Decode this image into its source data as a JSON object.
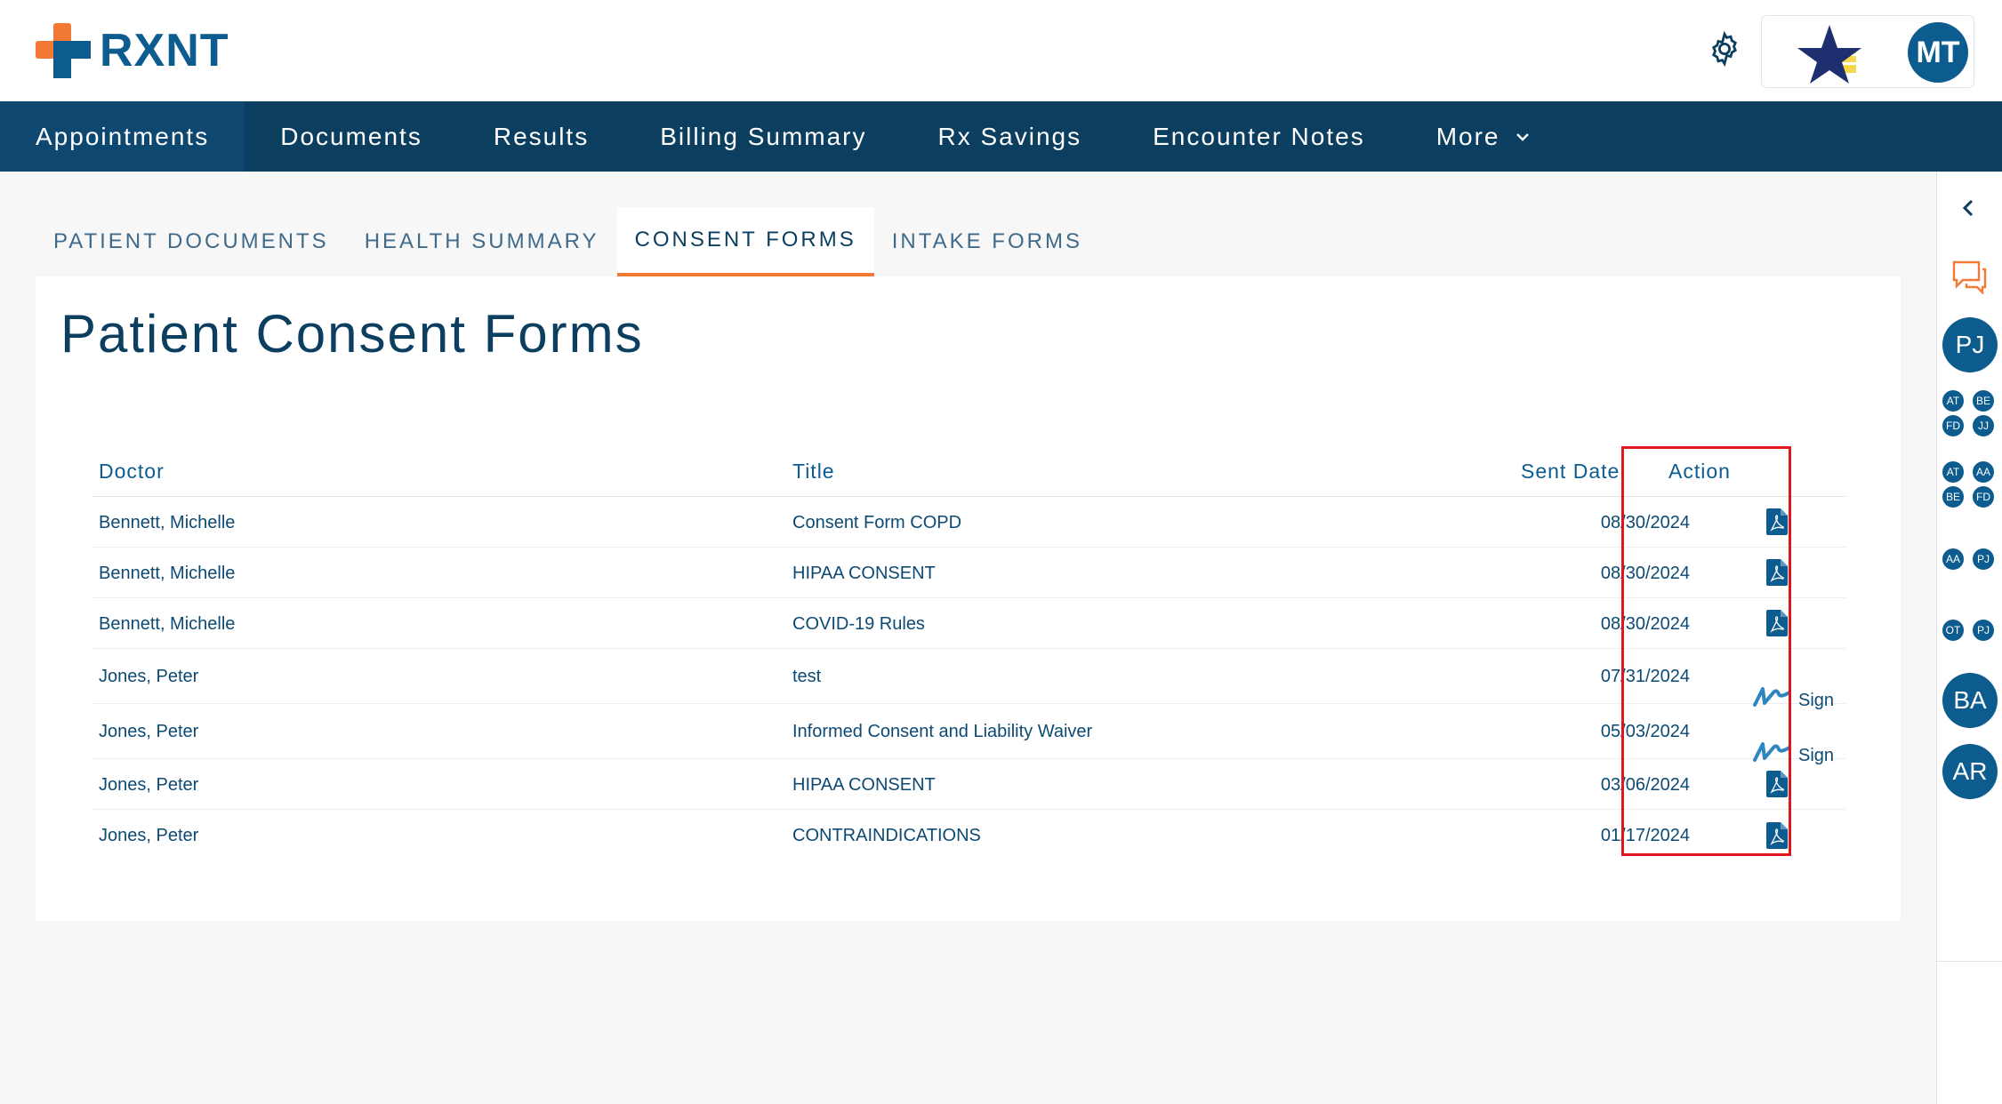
{
  "header": {
    "logo_text": "RXNT",
    "user_initials": "MT"
  },
  "nav": {
    "items": [
      "Appointments",
      "Documents",
      "Results",
      "Billing Summary",
      "Rx Savings",
      "Encounter Notes",
      "More"
    ]
  },
  "tabs": [
    "PATIENT DOCUMENTS",
    "HEALTH SUMMARY",
    "CONSENT FORMS",
    "INTAKE FORMS"
  ],
  "page": {
    "title": "Patient Consent Forms"
  },
  "table": {
    "headers": {
      "doctor": "Doctor",
      "title": "Title",
      "sent_date": "Sent Date",
      "action": "Action"
    },
    "rows": [
      {
        "doctor": "Bennett, Michelle",
        "title": "Consent Form COPD",
        "sent_date": "08/30/2024",
        "action": "pdf"
      },
      {
        "doctor": "Bennett, Michelle",
        "title": "HIPAA CONSENT",
        "sent_date": "08/30/2024",
        "action": "pdf"
      },
      {
        "doctor": "Bennett, Michelle",
        "title": "COVID-19 Rules",
        "sent_date": "08/30/2024",
        "action": "pdf"
      },
      {
        "doctor": "Jones, Peter",
        "title": "test",
        "sent_date": "07/31/2024",
        "action": "sign",
        "action_label": "Sign"
      },
      {
        "doctor": "Jones, Peter",
        "title": "Informed Consent and Liability Waiver",
        "sent_date": "05/03/2024",
        "action": "sign",
        "action_label": "Sign"
      },
      {
        "doctor": "Jones, Peter",
        "title": "HIPAA CONSENT",
        "sent_date": "03/06/2024",
        "action": "pdf"
      },
      {
        "doctor": "Jones, Peter",
        "title": "CONTRAINDICATIONS",
        "sent_date": "01/17/2024",
        "action": "pdf"
      }
    ]
  },
  "rail": {
    "avatars_big": [
      "PJ",
      "BA",
      "AR"
    ],
    "group1": [
      "AT",
      "BE",
      "FD",
      "JJ"
    ],
    "group2": [
      "AT",
      "AA",
      "BE",
      "FD"
    ],
    "group3": [
      "AA",
      "PJ"
    ],
    "group4": [
      "OT",
      "PJ"
    ]
  },
  "icons": [
    "settings-gear-icon",
    "pdf-file-icon",
    "signature-icon",
    "chevron-down-icon",
    "chevron-left-icon",
    "chat-bubble-icon"
  ],
  "colors": {
    "brand_blue": "#0d5c8f",
    "nav_bg": "#0b3e5f",
    "accent_orange": "#f37a36",
    "highlight_red": "#e0161f"
  }
}
